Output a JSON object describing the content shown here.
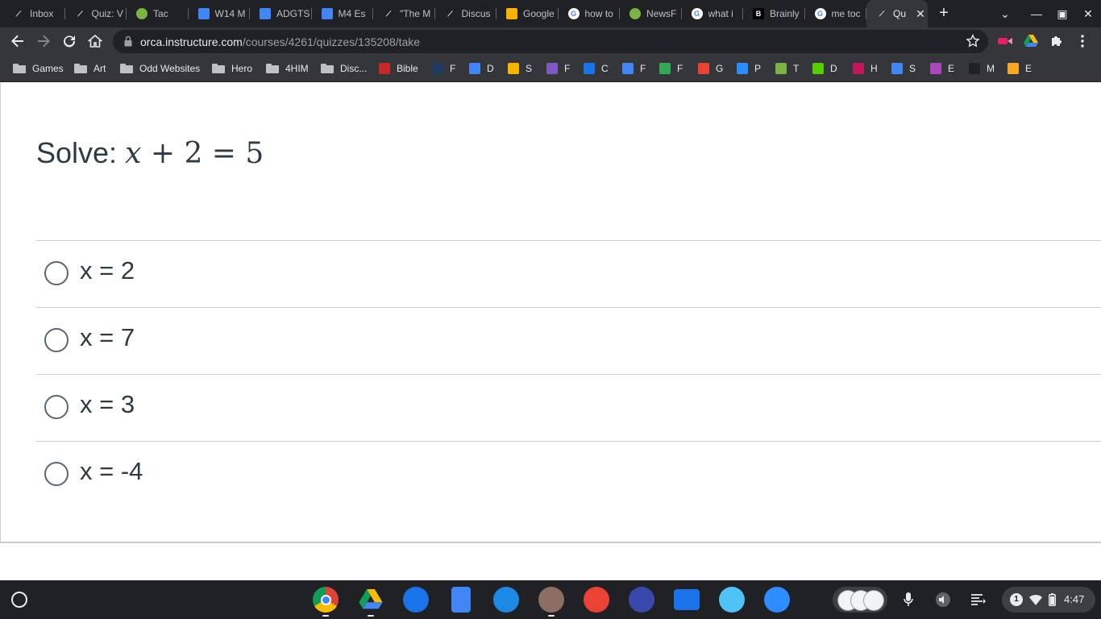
{
  "browser": {
    "tabs": [
      {
        "title": "Inbox",
        "icon": "canvas-icon",
        "color": "#202124"
      },
      {
        "title": "Quiz: V",
        "icon": "canvas-icon",
        "color": "#202124"
      },
      {
        "title": "Tac",
        "icon": "green-swirl-icon",
        "color": "#7cb342"
      },
      {
        "title": "W14 M",
        "icon": "docs-icon",
        "color": "#4285f4"
      },
      {
        "title": "ADGTS",
        "icon": "docs-icon",
        "color": "#4285f4"
      },
      {
        "title": "M4 Es",
        "icon": "docs-icon",
        "color": "#4285f4"
      },
      {
        "title": "\"The M",
        "icon": "canvas-icon",
        "color": "#202124"
      },
      {
        "title": "Discus",
        "icon": "canvas-icon",
        "color": "#202124"
      },
      {
        "title": "Google",
        "icon": "slides-icon",
        "color": "#f4b400"
      },
      {
        "title": "how to",
        "icon": "google-icon",
        "color": "#ffffff"
      },
      {
        "title": "NewsF",
        "icon": "green-swirl-icon",
        "color": "#7cb342"
      },
      {
        "title": "what i",
        "icon": "google-icon",
        "color": "#ffffff"
      },
      {
        "title": "Brainly",
        "icon": "brainly-icon",
        "color": "#000000"
      },
      {
        "title": "me toc",
        "icon": "google-icon",
        "color": "#ffffff"
      },
      {
        "title": "Qu",
        "icon": "canvas-icon",
        "color": "#202124",
        "active": true
      }
    ],
    "new_tab_symbol": "+",
    "url_host": "orca.instructure.com",
    "url_path": "/courses/4261/quizzes/135208/take",
    "bookmarks": [
      {
        "label": "Games",
        "type": "folder"
      },
      {
        "label": "Art",
        "type": "folder"
      },
      {
        "label": "Odd Websites",
        "type": "folder"
      },
      {
        "label": "Hero",
        "type": "folder"
      },
      {
        "label": "4HIM",
        "type": "folder"
      },
      {
        "label": "Disc...",
        "type": "folder"
      },
      {
        "label": "Bible",
        "type": "link",
        "icon": "bible-icon",
        "color": "#c62828"
      },
      {
        "label": "F",
        "type": "link",
        "icon": "cross-icon",
        "color": "#1e3a5f"
      },
      {
        "label": "D",
        "type": "link",
        "icon": "docs-icon",
        "color": "#4285f4"
      },
      {
        "label": "S",
        "type": "link",
        "icon": "slides-icon",
        "color": "#f4b400"
      },
      {
        "label": "F",
        "type": "link",
        "icon": "forms-icon",
        "color": "#7e57c2"
      },
      {
        "label": "C",
        "type": "link",
        "icon": "contacts-icon",
        "color": "#1a73e8"
      },
      {
        "label": "F",
        "type": "link",
        "icon": "docs-icon",
        "color": "#4285f4"
      },
      {
        "label": "F",
        "type": "link",
        "icon": "gem-icon",
        "color": "#34a853"
      },
      {
        "label": "G",
        "type": "link",
        "icon": "gmail-icon",
        "color": "#ea4335"
      },
      {
        "label": "P",
        "type": "link",
        "icon": "zoom-icon",
        "color": "#2d8cff"
      },
      {
        "label": "T",
        "type": "link",
        "icon": "green-swirl-icon",
        "color": "#7cb342"
      },
      {
        "label": "D",
        "type": "link",
        "icon": "duolingo-icon",
        "color": "#58cc02"
      },
      {
        "label": "H",
        "type": "link",
        "icon": "striped-icon",
        "color": "#c2185b"
      },
      {
        "label": "S",
        "type": "link",
        "icon": "docs-icon",
        "color": "#4285f4"
      },
      {
        "label": "E",
        "type": "link",
        "icon": "purple-icon",
        "color": "#ab47bc"
      },
      {
        "label": "M",
        "type": "link",
        "icon": "canvas-icon",
        "color": "#202124"
      },
      {
        "label": "E",
        "type": "link",
        "icon": "character-icon",
        "color": "#f9a825"
      }
    ]
  },
  "quiz": {
    "question_prefix": "Solve:",
    "equation_var": "x",
    "equation_rest": "+ 2 = 5",
    "answers": [
      {
        "label": "x = 2"
      },
      {
        "label": "x = 7"
      },
      {
        "label": "x = 3"
      },
      {
        "label": "x = -4"
      }
    ]
  },
  "shelf": {
    "apps": [
      {
        "name": "chrome-icon",
        "color": "#db4437",
        "running": true
      },
      {
        "name": "drive-icon",
        "color": "#0f9d58",
        "running": true
      },
      {
        "name": "camera-icon",
        "color": "#1a73e8"
      },
      {
        "name": "docs-icon",
        "color": "#4285f4"
      },
      {
        "name": "helm-icon",
        "color": "#ffffff"
      },
      {
        "name": "game-icon",
        "color": "#8d6e63",
        "running": true
      },
      {
        "name": "palette-icon",
        "color": "#ea4335"
      },
      {
        "name": "cursive-icon",
        "color": "#3949ab"
      },
      {
        "name": "files-icon",
        "color": "#1a73e8"
      },
      {
        "name": "canvas-app-icon",
        "color": "#4fc3f7"
      },
      {
        "name": "zoom-icon",
        "color": "#2d8cff"
      }
    ],
    "notification_count": "1",
    "time": "4:47"
  }
}
